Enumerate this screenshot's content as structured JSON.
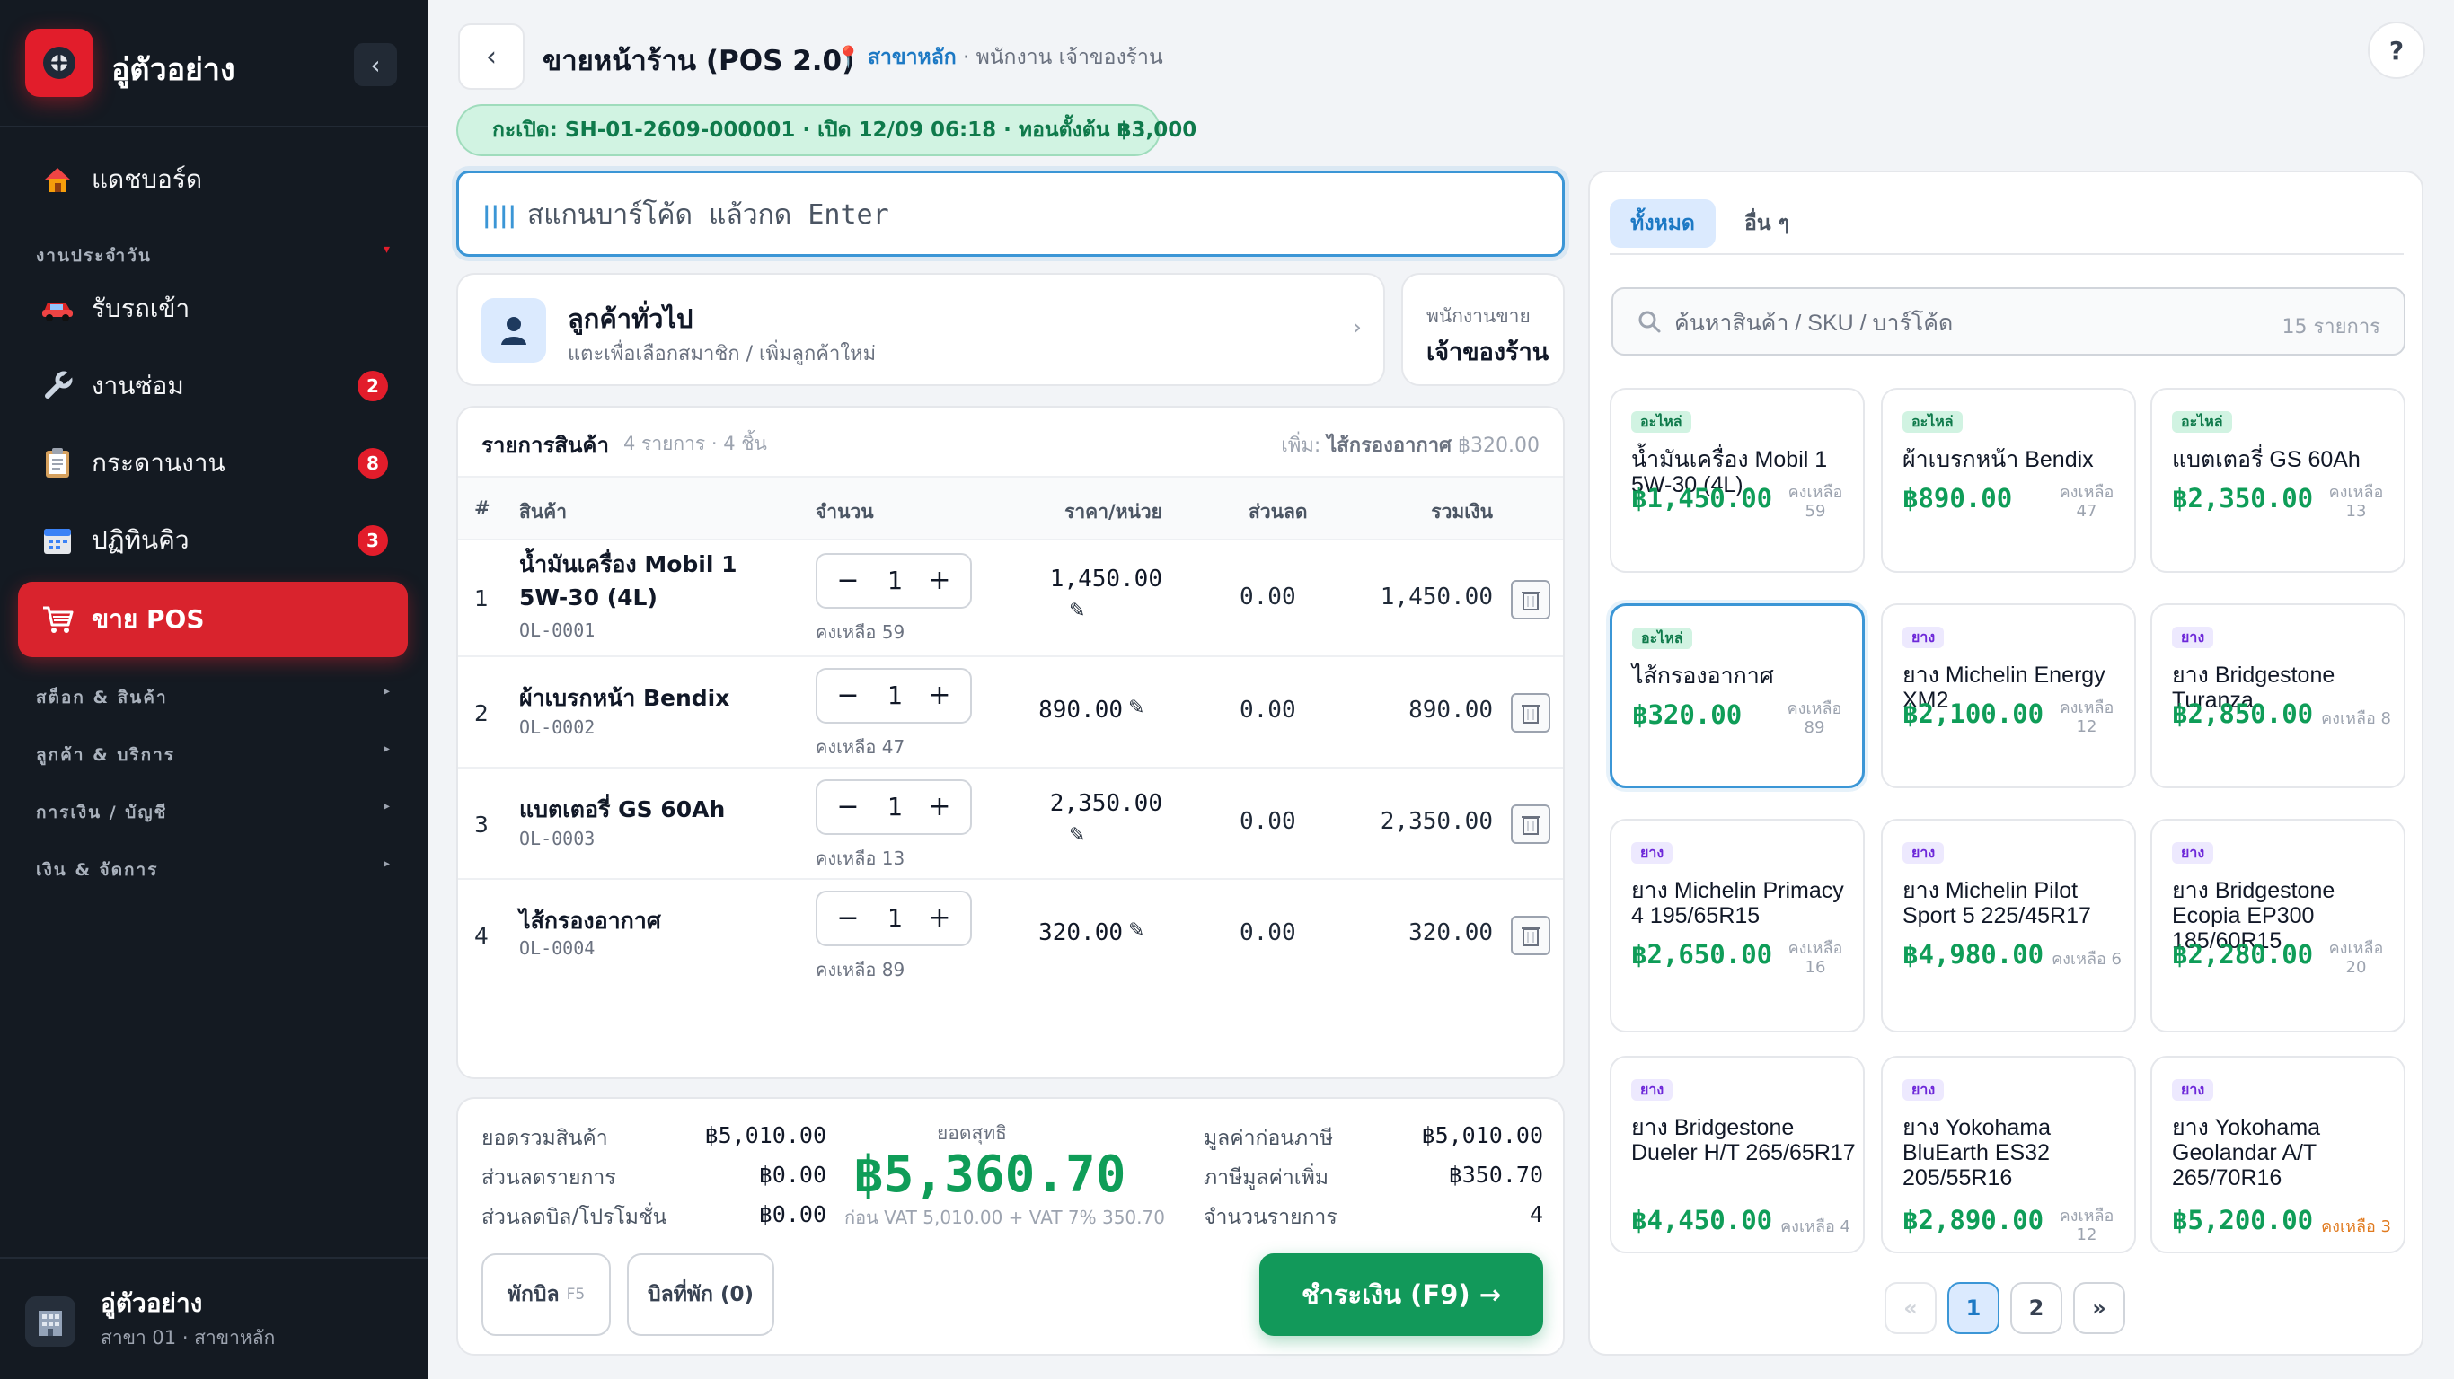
{
  "app": {
    "name": "อู่ตัวอย่าง",
    "collapse_glyph": "‹"
  },
  "nav": {
    "dashboard": "แดชบอร์ด",
    "section_daily": "งานประจำวัน",
    "receive_car": "รับรถเข้า",
    "repair": {
      "label": "งานซ่อม",
      "badge": "2"
    },
    "board": {
      "label": "กระดานงาน",
      "badge": "8"
    },
    "calendar": {
      "label": "ปฏิทินคิว",
      "badge": "3"
    },
    "pos": "ขาย POS",
    "section_stock": "สต็อก & สินค้า",
    "section_customer": "ลูกค้า & บริการ",
    "section_finance": "การเงิน / บัญชี",
    "section_admin": "เงิน & จัดการ"
  },
  "user": {
    "name": "อู่ตัวอย่าง",
    "branch": "สาขา 01 · สาขาหลัก"
  },
  "header": {
    "title": "ขายหน้าร้าน (POS 2.0)",
    "branch_name": "สาขาหลัก",
    "staff_line": " · พนักงาน เจ้าของร้าน",
    "shift": "กะเปิด: SH-01-2609-000001 · เปิด 12/09 06:18 · ทอนตั้งต้น ฿3,000",
    "help": "?"
  },
  "scan": {
    "placeholder": "สแกนบาร์โค้ด แล้วกด Enter",
    "value": ""
  },
  "customer": {
    "name": "ลูกค้าทั่วไป",
    "hint": "แตะเพื่อเลือกสมาชิก / เพิ่มลูกค้าใหม่"
  },
  "salesperson": {
    "label": "พนักงานขาย",
    "value": "เจ้าของร้าน"
  },
  "items": {
    "heading": "รายการสินค้า",
    "count": "4 รายการ · 4 ชิ้น",
    "added_prefix": "เพิ่ม: ",
    "added_name": "ไส้กรองอากาศ",
    "added_price": " ฿320.00",
    "columns": [
      "#",
      "สินค้า",
      "จำนวน",
      "ราคา/หน่วย",
      "ส่วนลด",
      "รวมเงิน"
    ],
    "rows": [
      {
        "no": "1",
        "name": "น้ำมันเครื่อง Mobil 1 5W-30 (4L)",
        "sku": "OL-0001",
        "qty": "1",
        "left": "คงเหลือ 59",
        "price": "1,450.00",
        "discount": "0.00",
        "total": "1,450.00"
      },
      {
        "no": "2",
        "name": "ผ้าเบรกหน้า Bendix",
        "sku": "OL-0002",
        "qty": "1",
        "left": "คงเหลือ 47",
        "price": "890.00",
        "discount": "0.00",
        "total": "890.00"
      },
      {
        "no": "3",
        "name": "แบตเตอรี่ GS 60Ah",
        "sku": "OL-0003",
        "qty": "1",
        "left": "คงเหลือ 13",
        "price": "2,350.00",
        "discount": "0.00",
        "total": "2,350.00"
      },
      {
        "no": "4",
        "name": "ไส้กรองอากาศ",
        "sku": "OL-0004",
        "qty": "1",
        "left": "คงเหลือ 89",
        "price": "320.00",
        "discount": "0.00",
        "total": "320.00"
      }
    ]
  },
  "totals": {
    "subtotal_label": "ยอดรวมสินค้า",
    "subtotal": "฿5,010.00",
    "item_disc_label": "ส่วนลดรายการ",
    "item_disc": "฿0.00",
    "bill_disc_label": "ส่วนลดบิล/โปรโมชั่น",
    "bill_disc": "฿0.00",
    "net_label": "ยอดสุทธิ",
    "net": "฿5,360.70",
    "net_note": "ก่อน VAT 5,010.00 + VAT 7% 350.70",
    "pretax_label": "มูลค่าก่อนภาษี",
    "pretax": "฿5,010.00",
    "vat_label": "ภาษีมูลค่าเพิ่ม",
    "vat": "฿350.70",
    "count_label": "จำนวนรายการ",
    "count": "4"
  },
  "actions": {
    "hold": "พักบิล",
    "hold_key": "F5",
    "held": "บิลที่พัก (0)",
    "pay": "ชำระเงิน (F9) →"
  },
  "catalog": {
    "tabs": [
      "ทั้งหมด",
      "อื่น ๆ"
    ],
    "search_placeholder": "ค้นหาสินค้า / SKU / บาร์โค้ด",
    "search_value": "",
    "result_count": "15 รายการ",
    "products": [
      {
        "cat": "อะไหล่",
        "name": "น้ำมันเครื่อง Mobil 1 5W-30 (4L)",
        "price": "฿1,450.00",
        "stock": "คงเหลือ 59"
      },
      {
        "cat": "อะไหล่",
        "name": "ผ้าเบรกหน้า Bendix",
        "price": "฿890.00",
        "stock": "คงเหลือ 47"
      },
      {
        "cat": "อะไหล่",
        "name": "แบตเตอรี่ GS 60Ah",
        "price": "฿2,350.00",
        "stock": "คงเหลือ 13"
      },
      {
        "cat": "อะไหล่",
        "name": "ไส้กรองอากาศ",
        "price": "฿320.00",
        "stock": "คงเหลือ 89"
      },
      {
        "cat": "ยาง",
        "name": "ยาง Michelin Energy XM2",
        "price": "฿2,100.00",
        "stock": "คงเหลือ 12"
      },
      {
        "cat": "ยาง",
        "name": "ยาง Bridgestone Turanza",
        "price": "฿2,850.00",
        "stock": "คงเหลือ 8"
      },
      {
        "cat": "ยาง",
        "name": "ยาง Michelin Primacy 4 195/65R15",
        "price": "฿2,650.00",
        "stock": "คงเหลือ 16"
      },
      {
        "cat": "ยาง",
        "name": "ยาง Michelin Pilot Sport 5 225/45R17",
        "price": "฿4,980.00",
        "stock": "คงเหลือ 6"
      },
      {
        "cat": "ยาง",
        "name": "ยาง Bridgestone Ecopia EP300 185/60R15",
        "price": "฿2,280.00",
        "stock": "คงเหลือ 20"
      },
      {
        "cat": "ยาง",
        "name": "ยาง Bridgestone Dueler H/T 265/65R17",
        "price": "฿4,450.00",
        "stock": "คงเหลือ 4"
      },
      {
        "cat": "ยาง",
        "name": "ยาง Yokohama BluEarth ES32 205/55R16",
        "price": "฿2,890.00",
        "stock": "คงเหลือ 12"
      },
      {
        "cat": "ยาง",
        "name": "ยาง Yokohama Geolandar A/T 265/70R16",
        "price": "฿5,200.00",
        "stock": "คงเหลือ 3"
      }
    ],
    "pagination": {
      "prev": "«",
      "pages": [
        "1",
        "2"
      ],
      "next": "»"
    }
  },
  "colors": {
    "brand": "#e21d2b",
    "accent": "#3b96d6",
    "success": "#0f9d58"
  }
}
